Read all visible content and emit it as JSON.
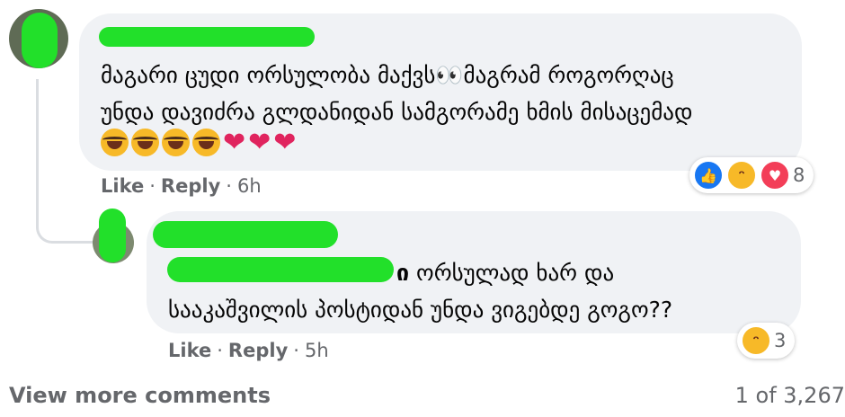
{
  "comment": {
    "text": "მაგარი ცუდი ორსულობა მაქვს👀მაგრამ როგორღაც\nუნდა დავიძრა გლდანიდან სამგორამე ხმის მისაცემად",
    "meta": {
      "like": "Like",
      "reply": "Reply",
      "time": "6h"
    },
    "reactions": {
      "icons": [
        "like-icon",
        "haha-icon",
        "love-icon"
      ],
      "count": "8"
    }
  },
  "reply": {
    "mention_tail": "ი",
    "text": " ორსულად ხარ და\nსააკაშვილის პოსტიდან უნდა ვიგებდე გოგო??",
    "meta": {
      "like": "Like",
      "reply": "Reply",
      "time": "5h"
    },
    "reactions": {
      "icons": [
        "haha-icon"
      ],
      "count": "3"
    }
  },
  "footer": {
    "view_more": "View more comments",
    "count": "1 of 3,267"
  },
  "colors": {
    "bubble": "#f0f2f5",
    "scribble": "#22e02a",
    "meta_text": "#65676b",
    "like": "#1877f2",
    "love": "#f33e58",
    "haha": "#f7b928"
  }
}
